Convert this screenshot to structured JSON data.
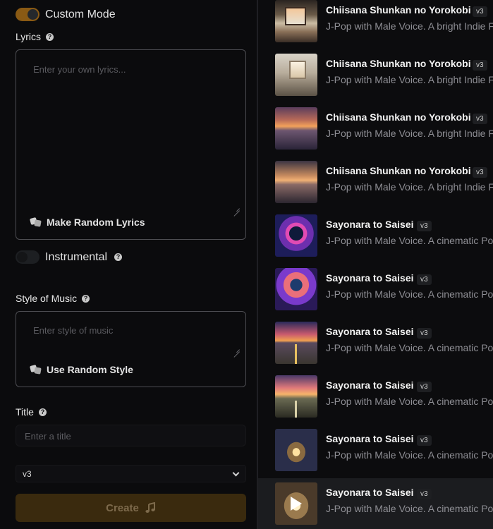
{
  "form": {
    "custom_mode_label": "Custom Mode",
    "lyrics_label": "Lyrics",
    "lyrics_placeholder": "Enter your own lyrics...",
    "random_lyrics_label": "Make Random Lyrics",
    "instrumental_label": "Instrumental",
    "style_label": "Style of Music",
    "style_placeholder": "Enter style of music",
    "random_style_label": "Use Random Style",
    "title_label": "Title",
    "title_placeholder": "Enter a title",
    "version_value": "v3",
    "create_label": "Create"
  },
  "songs": [
    {
      "title": "Chiisana Shunkan no Yorokobi",
      "version": "v3",
      "desc": "J-Pop with Male Voice. A bright Indie F"
    },
    {
      "title": "Chiisana Shunkan no Yorokobi",
      "version": "v3",
      "desc": "J-Pop with Male Voice. A bright Indie F"
    },
    {
      "title": "Chiisana Shunkan no Yorokobi",
      "version": "v3",
      "desc": "J-Pop with Male Voice. A bright Indie F"
    },
    {
      "title": "Chiisana Shunkan no Yorokobi",
      "version": "v3",
      "desc": "J-Pop with Male Voice. A bright Indie F"
    },
    {
      "title": "Sayonara to Saisei",
      "version": "v3",
      "desc": "J-Pop with Male Voice. A cinematic Po"
    },
    {
      "title": "Sayonara to Saisei",
      "version": "v3",
      "desc": "J-Pop with Male Voice. A cinematic Po"
    },
    {
      "title": "Sayonara to Saisei",
      "version": "v3",
      "desc": "J-Pop with Male Voice. A cinematic Po"
    },
    {
      "title": "Sayonara to Saisei",
      "version": "v3",
      "desc": "J-Pop with Male Voice. A cinematic Po"
    },
    {
      "title": "Sayonara to Saisei",
      "version": "v3",
      "desc": "J-Pop with Male Voice. A cinematic Po"
    },
    {
      "title": "Sayonara to Saisei",
      "version": "v3",
      "desc": "J-Pop with Male Voice. A cinematic Po"
    }
  ],
  "colors": {
    "accent": "#8a5a14",
    "create_bg": "#3a2a0e",
    "background": "#0b0b0d"
  }
}
